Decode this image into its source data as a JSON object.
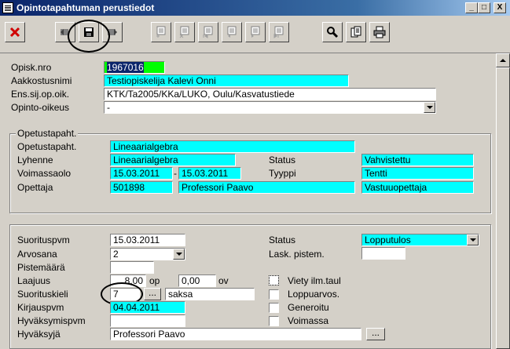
{
  "window": {
    "title": "Opintotapahtuman perustiedot",
    "minimize": "_",
    "restore": "□",
    "close": "X"
  },
  "toolbar": {
    "buttons": [
      "close-record",
      "first",
      "save",
      "last",
      "new",
      "delete",
      "nav-first",
      "nav-prev",
      "nav-next",
      "nav-last",
      "search",
      "copy",
      "print"
    ]
  },
  "student": {
    "opisk_nro_label": "Opisk.nro",
    "opisk_nro": "1967016",
    "aakkostusnimi_label": "Aakkostusnimi",
    "aakkostusnimi": "Testiopiskelija Kalevi Onni",
    "ens_sij_label": "Ens.sij.op.oik.",
    "ens_sij": "KTK/Ta2005/KKa/LUKO, Oulu/Kasvatustiede",
    "opinto_oikeus_label": "Opinto-oikeus",
    "opinto_oikeus": "-"
  },
  "opetustapahtuma": {
    "legend": "Opetustapaht.",
    "opetustapaht_label": "Opetustapaht.",
    "opetustapaht": "Lineaarialgebra",
    "lyhenne_label": "Lyhenne",
    "lyhenne": "Lineaarialgebra",
    "status_label": "Status",
    "status": "Vahvistettu",
    "voimassaolo_label": "Voimassaolo",
    "voimassa_from": "15.03.2011",
    "voimassa_sep": "-",
    "voimassa_to": "15.03.2011",
    "tyyppi_label": "Tyyppi",
    "tyyppi": "Tentti",
    "opettaja_label": "Opettaja",
    "opettaja_id": "501898",
    "opettaja_name": "Professori Paavo",
    "opettaja_role": "Vastuuopettaja"
  },
  "suoritus": {
    "suorituspvm_label": "Suorituspvm",
    "suorituspvm": "15.03.2011",
    "status_label": "Status",
    "status": "Lopputulos",
    "arvosana_label": "Arvosana",
    "arvosana": "2",
    "lask_pistem_label": "Lask. pistem.",
    "lask_pistem": "",
    "pistemaara_label": "Pistemäärä",
    "pistemaara": "",
    "laajuus_label": "Laajuus",
    "laajuus_op": "8,00",
    "op_label": "op",
    "laajuus_ov": "0,00",
    "ov_label": "ov",
    "viety_label": "Viety ilm.taul",
    "suorituskieli_label": "Suorituskieli",
    "suorituskieli_code": "7",
    "suorituskieli_name": "saksa",
    "loppuarvos_label": "Loppuarvos.",
    "kirjauspvm_label": "Kirjauspvm",
    "kirjauspvm": "04.04.2011",
    "generoitu_label": "Generoitu",
    "hyvaksymispvm_label": "Hyväksymispvm",
    "hyvaksymispvm": "",
    "voimassa_label": "Voimassa",
    "hyvaksyja_label": "Hyväksyjä",
    "hyvaksyja": "Professori Paavo",
    "ellipsis": "..."
  }
}
